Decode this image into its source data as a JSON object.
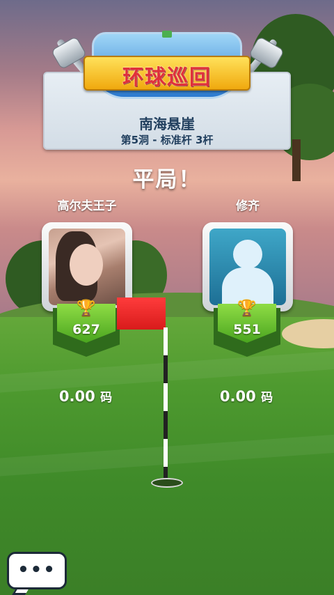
{
  "banner": {
    "tour_title": "环球巡回",
    "course_name": "南海悬崖",
    "hole_info": "第5洞 - 标准杆 3杆"
  },
  "result_text": "平局！",
  "players": [
    {
      "name": "高尔夫王子",
      "trophies": "627",
      "distance_value": "0.00",
      "distance_unit": "码",
      "avatar": "photo"
    },
    {
      "name": "修齐",
      "trophies": "551",
      "distance_value": "0.00",
      "distance_unit": "码",
      "avatar": "default-silhouette"
    }
  ],
  "chat": {
    "icon": "chat-bubble-icon",
    "dots": "•••"
  },
  "colors": {
    "flag": "#e82424",
    "badge": "#5cb82a",
    "panel_text": "#22405f"
  }
}
